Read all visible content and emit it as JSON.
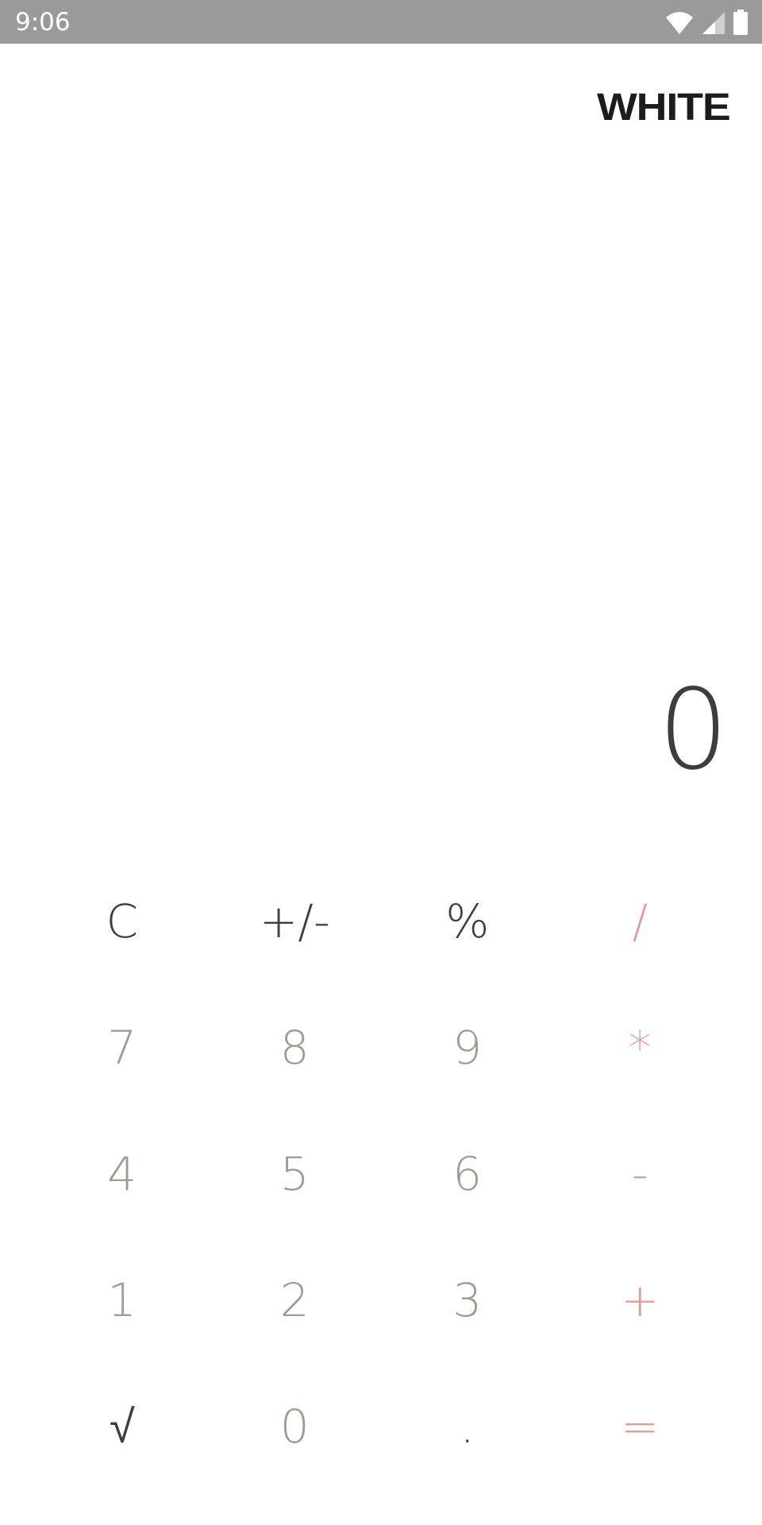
{
  "status_bar": {
    "time": "9:06",
    "icons": [
      "wifi-icon",
      "cellular-signal-icon",
      "battery-icon"
    ],
    "background": "#9a9a9a"
  },
  "header": {
    "brand": "WHITE"
  },
  "display": {
    "value": "0"
  },
  "keypad": {
    "rows": [
      [
        {
          "label": "C",
          "name": "clear-button",
          "kind": "fn"
        },
        {
          "label": "+/-",
          "name": "sign-toggle-button",
          "kind": "fn"
        },
        {
          "label": "%",
          "name": "percent-button",
          "kind": "fn"
        },
        {
          "label": "/",
          "name": "divide-button",
          "kind": "op"
        }
      ],
      [
        {
          "label": "7",
          "name": "digit-7-button",
          "kind": "num"
        },
        {
          "label": "8",
          "name": "digit-8-button",
          "kind": "num"
        },
        {
          "label": "9",
          "name": "digit-9-button",
          "kind": "num"
        },
        {
          "label": "*",
          "name": "multiply-button",
          "kind": "op"
        }
      ],
      [
        {
          "label": "4",
          "name": "digit-4-button",
          "kind": "num"
        },
        {
          "label": "5",
          "name": "digit-5-button",
          "kind": "num"
        },
        {
          "label": "6",
          "name": "digit-6-button",
          "kind": "num"
        },
        {
          "label": "-",
          "name": "subtract-button",
          "kind": "op"
        }
      ],
      [
        {
          "label": "1",
          "name": "digit-1-button",
          "kind": "num"
        },
        {
          "label": "2",
          "name": "digit-2-button",
          "kind": "num"
        },
        {
          "label": "3",
          "name": "digit-3-button",
          "kind": "num"
        },
        {
          "label": "+",
          "name": "add-button",
          "kind": "op"
        }
      ],
      [
        {
          "label": "√",
          "name": "square-root-button",
          "kind": "fn"
        },
        {
          "label": "0",
          "name": "digit-0-button",
          "kind": "num"
        },
        {
          "label": ".",
          "name": "decimal-point-button",
          "kind": "fn"
        },
        {
          "label": "=",
          "name": "equals-button",
          "kind": "op"
        }
      ]
    ]
  },
  "colors": {
    "function_keys": "#3e3e3e",
    "number_keys": "#9d9d94",
    "operator_keys": "#e59c98",
    "display_text": "#3d3d3d"
  }
}
